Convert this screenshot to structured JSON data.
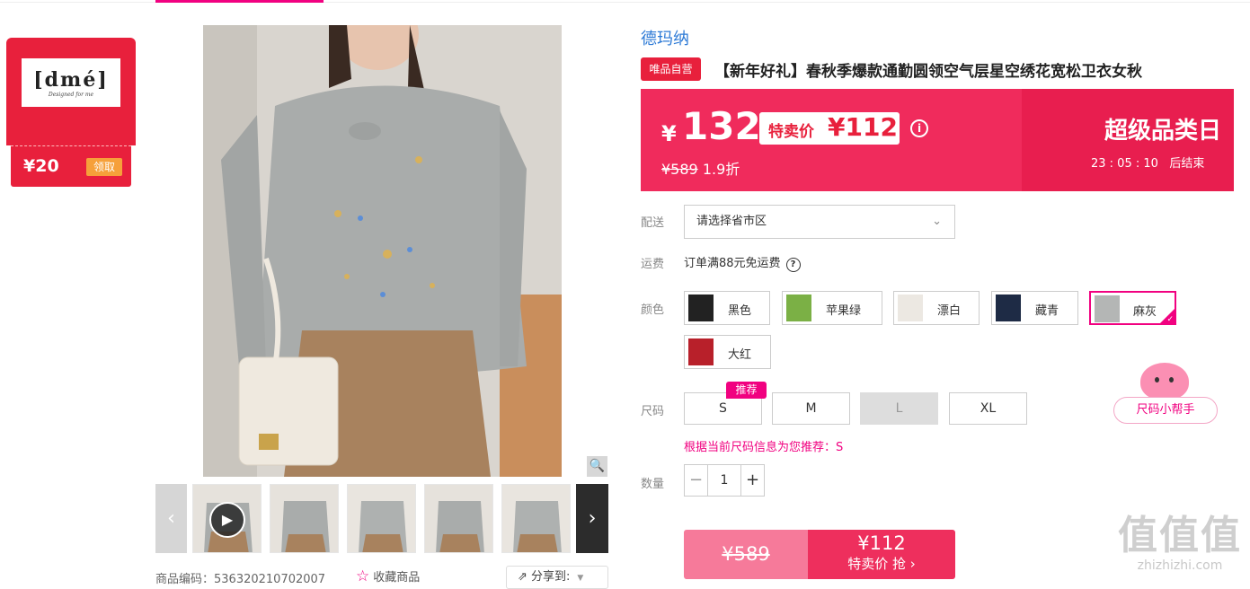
{
  "coupon": {
    "amount": "¥20",
    "action": "领取",
    "logo_text": "[dmé]",
    "logo_sub": "Designed for me"
  },
  "gallery": {
    "zoom_icon": "magnifier-icon"
  },
  "footer": {
    "sku_code": "商品编码：536320210702007",
    "favorite_label": "收藏商品",
    "share_label": "分享到:"
  },
  "product": {
    "brand": "德玛纳",
    "badge": "唯品自营",
    "title": "【新年好礼】春秋季爆款通勤圆领空气层星空绣花宽松卫衣女秋"
  },
  "pricing": {
    "currency": "¥",
    "price": "132",
    "sale_label": "特卖价",
    "sale_price": "¥112",
    "original_price": "¥589",
    "discount": "1.9折",
    "promo_title": "超级品类日",
    "countdown": "23 : 05 : 10",
    "countdown_suffix": "后结束",
    "accent_color": "#f02b5c"
  },
  "delivery": {
    "label": "配送",
    "placeholder": "请选择省市区"
  },
  "shipping": {
    "label": "运费",
    "text": "订单满88元免运费"
  },
  "colors": {
    "label": "颜色",
    "options": [
      {
        "name": "黑色"
      },
      {
        "name": "苹果绿"
      },
      {
        "name": "漂白"
      },
      {
        "name": "藏青"
      },
      {
        "name": "麻灰",
        "selected": true
      },
      {
        "name": "大红"
      }
    ]
  },
  "sizes": {
    "label": "尺码",
    "options": [
      {
        "name": "S"
      },
      {
        "name": "M"
      },
      {
        "name": "L",
        "disabled": true
      },
      {
        "name": "XL"
      }
    ],
    "recommend_badge": "推荐",
    "recommend_text": "根据当前尺码信息为您推荐：S",
    "helper_label": "尺码小帮手"
  },
  "quantity": {
    "label": "数量",
    "value": "1",
    "minus": "−",
    "plus": "+"
  },
  "buy": {
    "original": "¥589",
    "price": "¥112",
    "action": "特卖价 抢"
  },
  "watermark": {
    "big": "值值值",
    "small": "zhizhizhi.com"
  }
}
